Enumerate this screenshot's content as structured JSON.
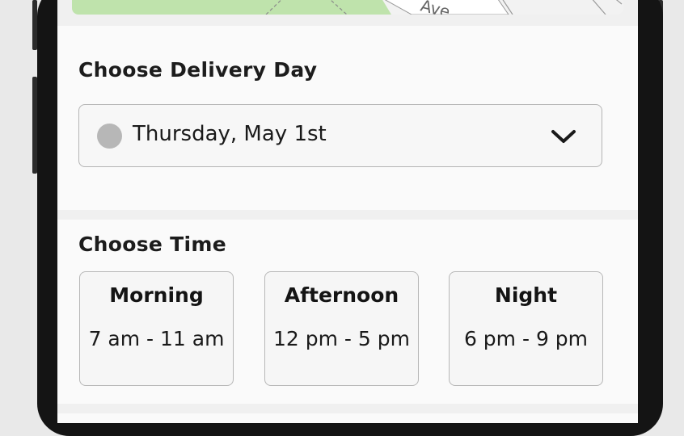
{
  "map": {
    "street_label": "Ave"
  },
  "delivery": {
    "title": "Choose Delivery Day",
    "selected_day": "Thursday, May 1st",
    "dropdown_icon": "chevron-down-icon"
  },
  "time": {
    "title": "Choose Time",
    "options": [
      {
        "label": "Morning",
        "range": "7 am - 11 am"
      },
      {
        "label": "Afternoon",
        "range": "12 pm - 5 pm"
      },
      {
        "label": "Night",
        "range": "6 pm - 9 pm"
      }
    ]
  },
  "colors": {
    "map_green": "#bfe3ac",
    "selector_dot": "#b7b7b7",
    "border": "#b4b4b4"
  }
}
